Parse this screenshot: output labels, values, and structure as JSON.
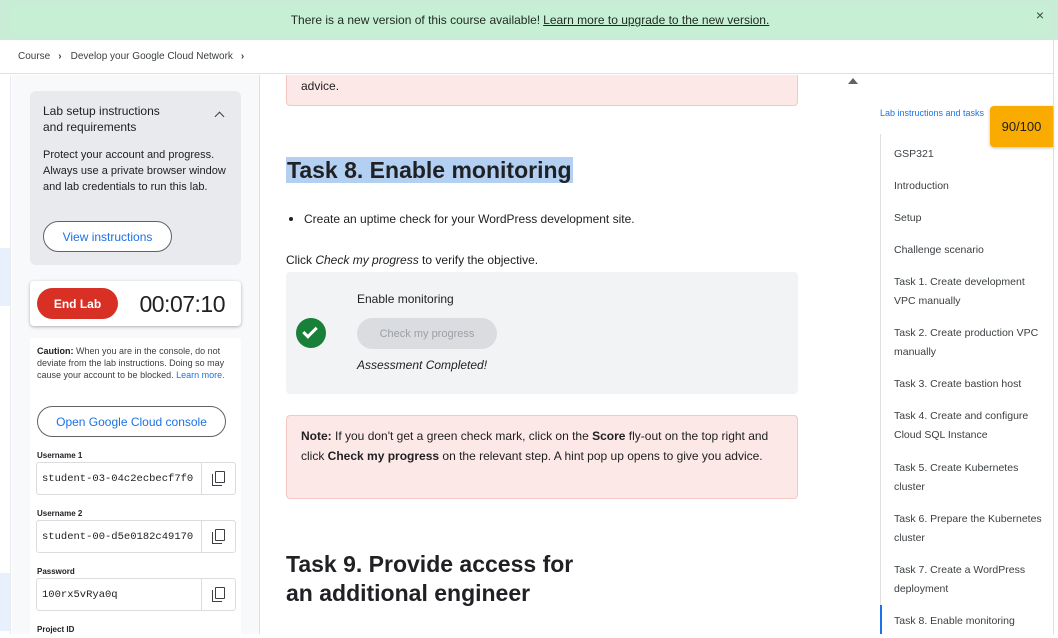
{
  "banner": {
    "text": "There is a new version of this course available!",
    "link": "Learn more to upgrade to the new version.",
    "close": "×"
  },
  "breadcrumb": {
    "items": [
      "Course",
      "Develop your Google Cloud Network"
    ],
    "separator": "›"
  },
  "sidebar": {
    "setup_title": "Lab setup instructions and requirements",
    "setup_body": "Protect your account and progress. Always use a private browser window and lab credentials to run this lab.",
    "view_button": "View instructions",
    "end_button": "End Lab",
    "timer": "00:07:10",
    "caution_label": "Caution:",
    "caution_text": "When you are in the console, do not deviate from the lab instructions. Doing so may cause your account to be blocked.",
    "learn_more": "Learn more.",
    "console_button": "Open Google Cloud console",
    "username1_label": "Username 1",
    "username1_value": "student-03-04c2ecbecf7f0",
    "username2_label": "Username 2",
    "username2_value": "student-00-d5e0182c49170",
    "password_label": "Password",
    "password_value": "100rx5vRya0q",
    "project_label": "Project ID"
  },
  "main": {
    "top_note_tail": "advice.",
    "task8_title": "Task 8. Enable monitoring",
    "task8_bullet": "Create an uptime check for your WordPress development site.",
    "click_prefix": "Click ",
    "click_em": "Check my progress",
    "click_suffix": " to verify the objective.",
    "check_title": "Enable monitoring",
    "check_button": "Check my progress",
    "check_status": "Assessment Completed!",
    "note_label": "Note:",
    "note_text_1": " If you don't get a green check mark, click on the ",
    "note_score": "Score",
    "note_text_2": " fly-out on the top right and click ",
    "note_check": "Check my progress",
    "note_text_3": " on the relevant step. A hint pop up opens to give you advice.",
    "task9_title_line1": "Task 9. Provide access for",
    "task9_title_line2": "an additional engineer"
  },
  "toc": {
    "title": "Lab instructions and tasks",
    "items": [
      "GSP321",
      "Introduction",
      "Setup",
      "Challenge scenario",
      "Task 1. Create development VPC manually",
      "Task 2. Create production VPC manually",
      "Task 3. Create bastion host",
      "Task 4. Create and configure Cloud SQL Instance",
      "Task 5. Create Kubernetes cluster",
      "Task 6. Prepare the Kubernetes cluster",
      "Task 7. Create a WordPress deployment",
      "Task 8. Enable monitoring"
    ]
  },
  "score": {
    "value": "90/100"
  },
  "colors": {
    "accent": "#1a73e8",
    "end_lab": "#d93025",
    "success": "#188038",
    "score": "#f9ab00",
    "note_bg": "#fce8e6"
  }
}
